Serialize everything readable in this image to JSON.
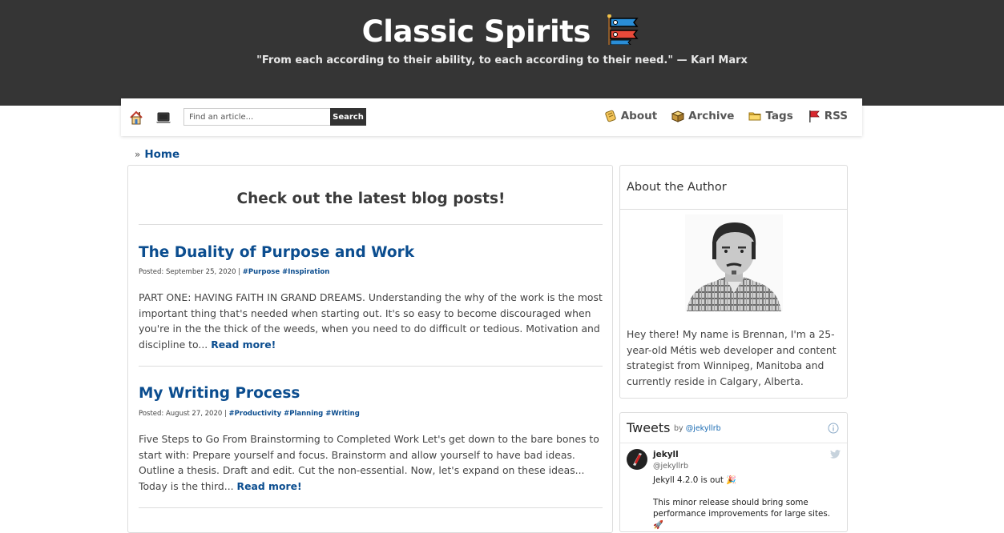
{
  "header": {
    "site_title": "Classic Spirits",
    "quote": "\"From each according to their ability, to each according to their need.\" — Karl Marx"
  },
  "nav": {
    "search_placeholder": "Find an article...",
    "search_label": "Search",
    "links": [
      {
        "label": "About",
        "icon": "scroll-icon"
      },
      {
        "label": "Archive",
        "icon": "package-icon"
      },
      {
        "label": "Tags",
        "icon": "folder-icon"
      },
      {
        "label": "RSS",
        "icon": "flag-icon"
      }
    ]
  },
  "breadcrumb": {
    "separator": "»",
    "home": "Home"
  },
  "main": {
    "heading": "Check out the latest blog posts!",
    "posts": [
      {
        "title": "The Duality of Purpose and Work",
        "posted": "Posted: September 25, 2020 |",
        "tags": "#Purpose #Inspiration",
        "excerpt": "PART ONE: HAVING FAITH IN GRAND DREAMS. Understanding the why of the work is the most important thing that's needed when starting out. It's so easy to become discouraged when you're in the the thick of the weeds, when you need to do difficult or tedious. Motivation and discipline to...",
        "read_more": "Read more!"
      },
      {
        "title": "My Writing Process",
        "posted": "Posted: August 27, 2020 |",
        "tags": "#Productivity #Planning #Writing",
        "excerpt": "Five Steps to Go From Brainstorming to Completed Work Let's get down to the bare bones to start with: Prepare yourself and focus. Brainstorm and allow yourself to have bad ideas. Outline a thesis. Draft and edit. Cut the non-essential. Now, let's expand on these ideas... Today is the third...",
        "read_more": "Read more!"
      }
    ]
  },
  "sidebar": {
    "author_title": "About the Author",
    "author_bio": "Hey there! My name is Brennan, I'm a 25-year-old Métis web developer and content strategist from Winnipeg, Manitoba and currently reside in Calgary, Alberta.",
    "tweets": {
      "title": "Tweets",
      "by_prefix": "by",
      "by_handle": "@jekyllrb",
      "name": "jekyll",
      "handle": "@jekyllrb",
      "line1": "Jekyll 4.2.0 is out 🎉",
      "line2": "This minor release should bring some performance improvements for large sites. 🚀"
    }
  },
  "colors": {
    "header_bg": "#353535",
    "link_blue": "#0b4d8f"
  }
}
